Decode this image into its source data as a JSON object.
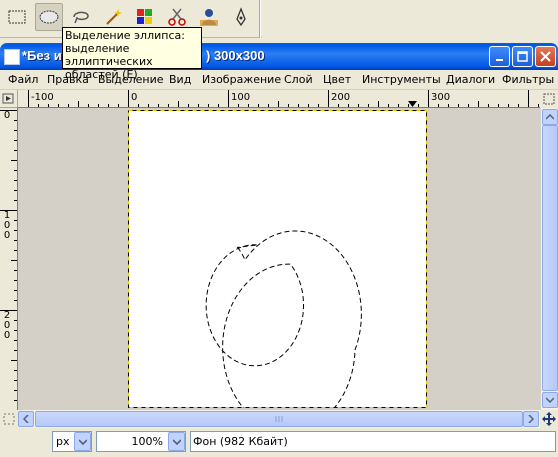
{
  "toolbox": {
    "tools": [
      {
        "name": "rect-select-icon",
        "active": false
      },
      {
        "name": "ellipse-select-icon",
        "active": true
      },
      {
        "name": "lasso-select-icon",
        "active": false
      },
      {
        "name": "magic-wand-icon",
        "active": false
      },
      {
        "name": "select-by-color-icon",
        "active": false
      },
      {
        "name": "scissors-icon",
        "active": false
      },
      {
        "name": "foreground-select-icon",
        "active": false
      },
      {
        "name": "paths-icon",
        "active": false
      }
    ],
    "tooltip": "Выделение эллипса:\nвыделение эллиптических\nобластей  (E)"
  },
  "window": {
    "title_start": "*Без и",
    "title_end": ") 300x300",
    "accent": "#0058e6"
  },
  "menu": [
    "Файл",
    "Правка",
    "Выделение",
    "Вид",
    "Изображение",
    "Слой",
    "Цвет",
    "Инструменты",
    "Диалоги",
    "Фильтры"
  ],
  "rulers": {
    "horizontal": [
      "-100",
      "0",
      "100",
      "200",
      "300"
    ],
    "vertical": [
      [
        "0"
      ],
      [
        "1",
        "0",
        "0"
      ],
      [
        "2",
        "0",
        "0"
      ]
    ]
  },
  "status": {
    "unit": "px",
    "zoom": "100%",
    "layer_info": "Фон (982 Кбайт)"
  }
}
